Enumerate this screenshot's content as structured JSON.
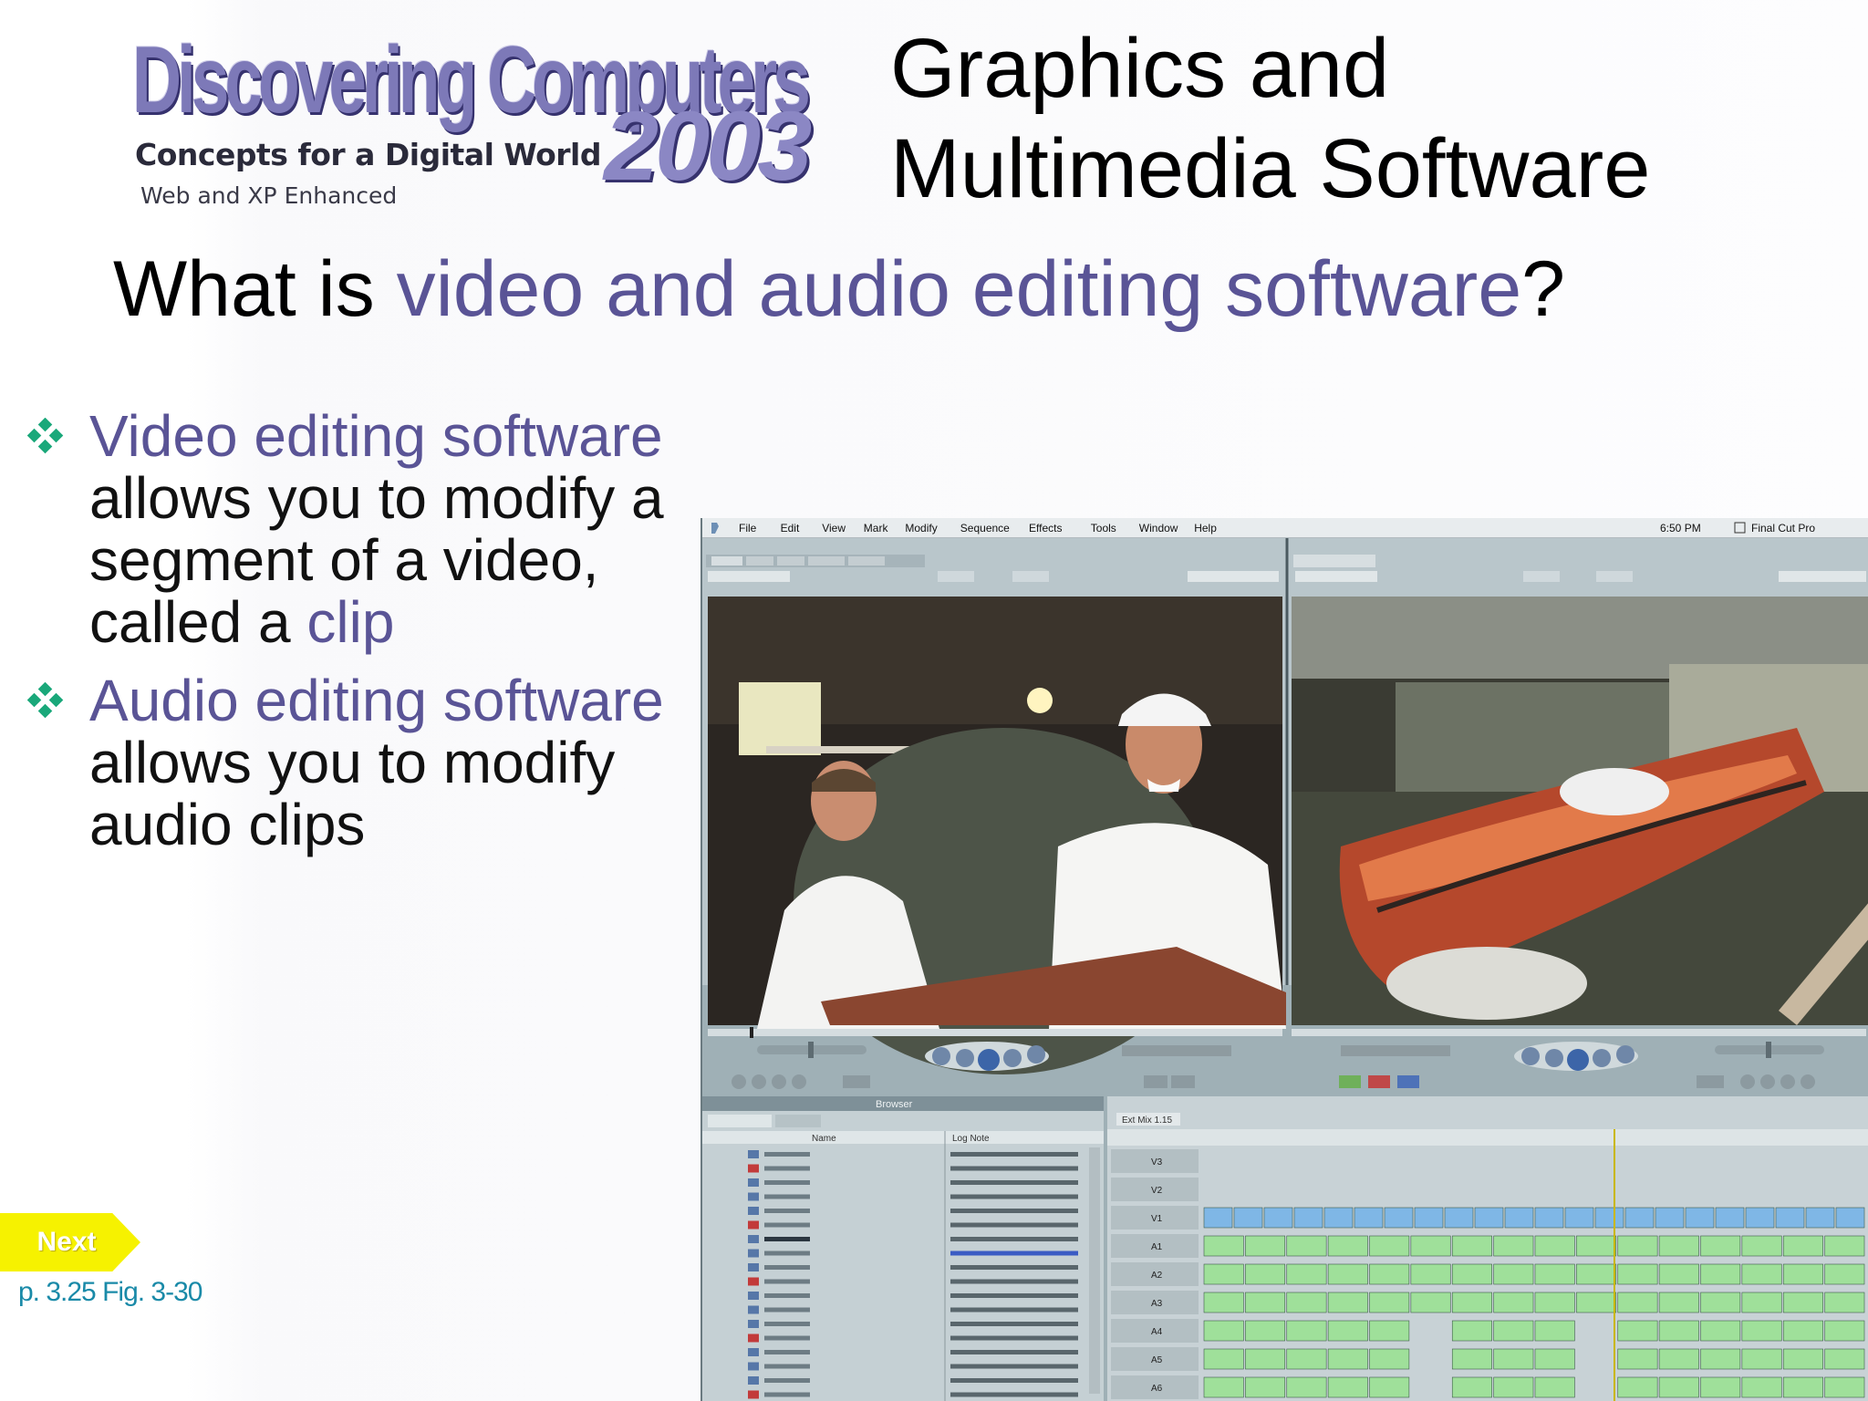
{
  "logo": {
    "title": "Discovering Computers",
    "year": "2003",
    "subtitle": "Concepts for a Digital World",
    "edition": "Web and XP Enhanced"
  },
  "header": {
    "line1": "Graphics and",
    "line2": "Multimedia Software"
  },
  "slide_title": {
    "prefix": "What is ",
    "highlight": "video and audio editing software",
    "suffix": "?"
  },
  "bullets": [
    {
      "term": "Video editing software",
      "text": " allows you to modify a segment of a video, called a ",
      "term2": "clip"
    },
    {
      "term": "Audio editing software",
      "text": " allows you to modify audio clips",
      "term2": ""
    }
  ],
  "next_label": "Next",
  "page_ref": "p. 3.25 Fig. 3-30",
  "figure": {
    "menu": [
      "File",
      "Edit",
      "View",
      "Mark",
      "Modify",
      "Sequence",
      "Effects",
      "Tools",
      "Window",
      "Help"
    ],
    "clock": "6:50 PM",
    "app_name": "Final Cut Pro",
    "browser_label": "Browser",
    "browser_col_name": "Name",
    "browser_col_log": "Log Note",
    "timeline_tab": "Ext Mix 1.15",
    "tracks": [
      "V3",
      "V2",
      "V1",
      "A1",
      "A2",
      "A3",
      "A4",
      "A5",
      "A6"
    ]
  },
  "colors": {
    "accent": "#5a5496",
    "bullet": "#1aa87a",
    "next_button": "#f6f200",
    "page_ref": "#1a8aa8"
  }
}
